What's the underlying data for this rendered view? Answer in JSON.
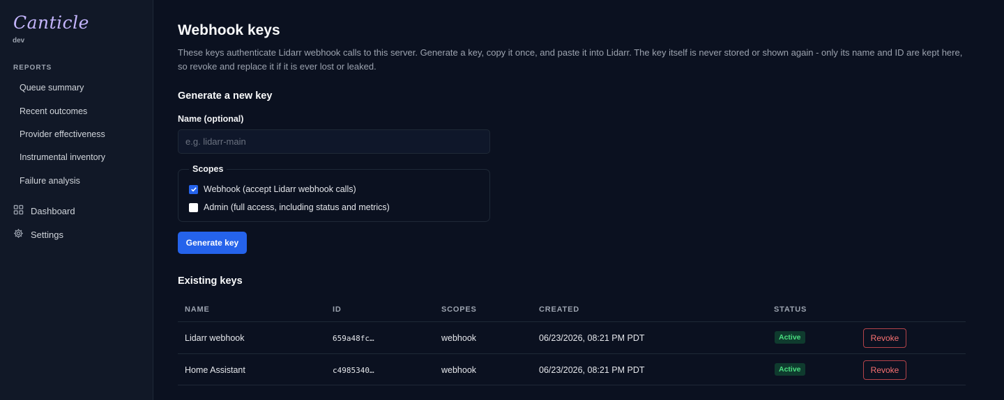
{
  "sidebar": {
    "brand": "Canticle",
    "env": "dev",
    "section_title": "REPORTS",
    "reports": [
      {
        "label": "Queue summary"
      },
      {
        "label": "Recent outcomes"
      },
      {
        "label": "Provider effectiveness"
      },
      {
        "label": "Instrumental inventory"
      },
      {
        "label": "Failure analysis"
      }
    ],
    "nav": [
      {
        "label": "Dashboard",
        "icon": "grid-icon"
      },
      {
        "label": "Settings",
        "icon": "gear-icon"
      }
    ]
  },
  "page": {
    "title": "Webhook keys",
    "description": "These keys authenticate Lidarr webhook calls to this server. Generate a key, copy it once, and paste it into Lidarr. The key itself is never stored or shown again - only its name and ID are kept here, so revoke and replace it if it is ever lost or leaked."
  },
  "generate": {
    "heading": "Generate a new key",
    "name_label": "Name (optional)",
    "name_value": "",
    "name_placeholder": "e.g. lidarr-main",
    "scopes_legend": "Scopes",
    "scopes": [
      {
        "label": "Webhook (accept Lidarr webhook calls)",
        "checked": true
      },
      {
        "label": "Admin (full access, including status and metrics)",
        "checked": false
      }
    ],
    "button_label": "Generate key"
  },
  "existing": {
    "heading": "Existing keys",
    "columns": [
      "NAME",
      "ID",
      "SCOPES",
      "CREATED",
      "STATUS"
    ],
    "rows": [
      {
        "name": "Lidarr webhook",
        "id": "659a48fc…",
        "scopes": "webhook",
        "created": "06/23/2026, 08:21 PM PDT",
        "status": "Active",
        "action": "Revoke"
      },
      {
        "name": "Home Assistant",
        "id": "c4985340…",
        "scopes": "webhook",
        "created": "06/23/2026, 08:21 PM PDT",
        "status": "Active",
        "action": "Revoke"
      }
    ]
  },
  "colors": {
    "background": "#0b1120",
    "sidebar": "#111827",
    "accent": "#2563eb",
    "brand": "#c4b5fd",
    "status_active": "#4ade80",
    "danger": "#f87171"
  }
}
